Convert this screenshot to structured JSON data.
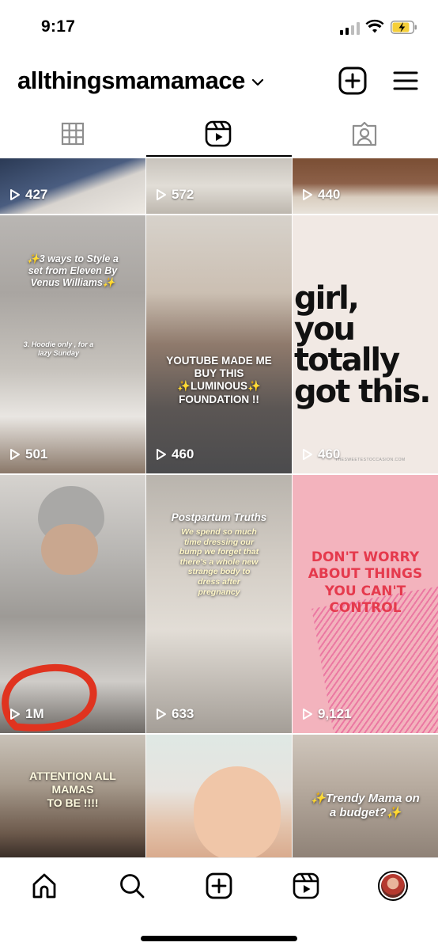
{
  "status_bar": {
    "time": "9:17"
  },
  "profile": {
    "username": "allthingsmamamace"
  },
  "tabs": [
    {
      "name": "grid",
      "icon": "grid-icon"
    },
    {
      "name": "reels",
      "icon": "reels-icon",
      "active": true
    },
    {
      "name": "tagged",
      "icon": "tagged-icon"
    }
  ],
  "reels": [
    {
      "views": "427"
    },
    {
      "views": "572"
    },
    {
      "views": "440"
    },
    {
      "views": "501",
      "caption_lines": [
        "✨3 ways to Style a",
        "set from Eleven By",
        "Venus Williams✨"
      ],
      "sub_caption": "3. Hoodie only , for a lazy Sunday"
    },
    {
      "views": "460",
      "caption_lines": [
        "YOUTUBE MADE ME",
        "BUY THIS",
        "✨LUMINOUS✨",
        "FOUNDATION !!"
      ]
    },
    {
      "views": "460",
      "caption_lines": [
        "girl,",
        "you",
        "totally",
        "got this."
      ],
      "small_text": "THESWEETESTOCCASION.COM"
    },
    {
      "views": "1M"
    },
    {
      "views": "633",
      "caption_title": "Postpartum Truths",
      "caption_lines": [
        "We spend so much",
        "time dressing our",
        "bump we forget that",
        "there's a whole new",
        "strange body to",
        "dress after",
        "pregnancy"
      ]
    },
    {
      "views": "9,121",
      "caption_lines": [
        "DON'T WORRY",
        "ABOUT THINGS",
        "YOU CAN'T",
        "CONTROL"
      ]
    },
    {
      "caption_lines": [
        "ATTENTION ALL",
        "MAMAS",
        "TO BE !!!!"
      ]
    },
    {
      "caption_lines": []
    },
    {
      "caption_lines": [
        "✨Trendy Mama on",
        "a budget?✨"
      ]
    }
  ],
  "bottom_nav": [
    {
      "name": "home",
      "icon": "home-icon"
    },
    {
      "name": "search",
      "icon": "search-icon"
    },
    {
      "name": "create",
      "icon": "create-icon"
    },
    {
      "name": "reels",
      "icon": "reels-icon"
    },
    {
      "name": "profile",
      "icon": "avatar"
    }
  ],
  "colors": {
    "text": "#000000",
    "background": "#ffffff",
    "pink_tile": "#f3b3bd",
    "pink_text": "#e53a4d"
  }
}
